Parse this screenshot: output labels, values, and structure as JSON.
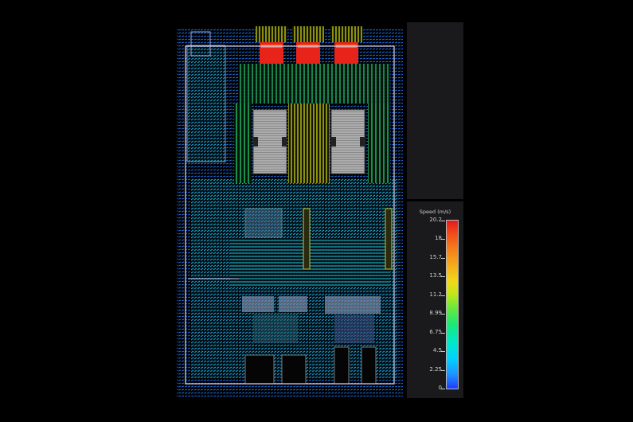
{
  "legend": {
    "title": "Speed (m/s)",
    "ticks": [
      "20.2",
      "18",
      "15.7",
      "13.5",
      "11.2",
      "8.99",
      "6.75",
      "4.5",
      "2.25",
      "0"
    ]
  },
  "colors": {
    "low": "#1e3cff",
    "mid": "#19e87a",
    "high": "#e51a1a"
  }
}
